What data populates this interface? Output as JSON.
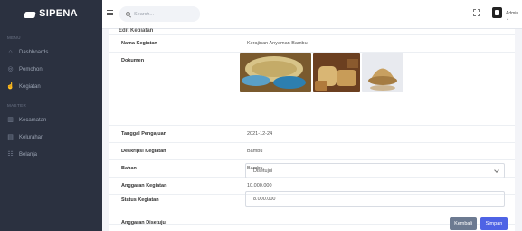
{
  "app": {
    "title": "SIPENA"
  },
  "sidebar": {
    "section_menu": "MENU",
    "section_master": "MASTER",
    "items": [
      {
        "label": "Dashboards",
        "icon": "home-icon"
      },
      {
        "label": "Pemohon",
        "icon": "user-icon"
      },
      {
        "label": "Kegiatan",
        "icon": "hand-icon"
      },
      {
        "label": "Kecamatan",
        "icon": "building-icon"
      },
      {
        "label": "Kelurahan",
        "icon": "map-icon"
      },
      {
        "label": "Belanja",
        "icon": "list-icon"
      }
    ]
  },
  "topbar": {
    "search_placeholder": "Search...",
    "user_label": "Admin"
  },
  "card": {
    "title": "Edit Kegiatan",
    "fields": [
      {
        "label": "Nama Kegiatan",
        "value": "Kerajinan Anyaman Bambu"
      },
      {
        "label": "Dokumen",
        "value": ""
      },
      {
        "label": "Tanggal Pengajuan",
        "value": "2021-12-24"
      },
      {
        "label": "Deskripsi Kegiatan",
        "value": "Bambu"
      },
      {
        "label": "Bahan",
        "value": "Bambu"
      },
      {
        "label": "Anggaran Kegiatan",
        "value": "10.000.000"
      }
    ],
    "status_label": "Status Kegiatan",
    "status_value": "Disetujui",
    "approved_label": "Anggaran Disetujui",
    "approved_value": "8.000.000",
    "back_label": "Kembali",
    "save_label": "Simpan"
  },
  "colors": {
    "sidebar_bg": "#2b3140",
    "primary": "#4e63e5",
    "secondary": "#6c7a91"
  }
}
